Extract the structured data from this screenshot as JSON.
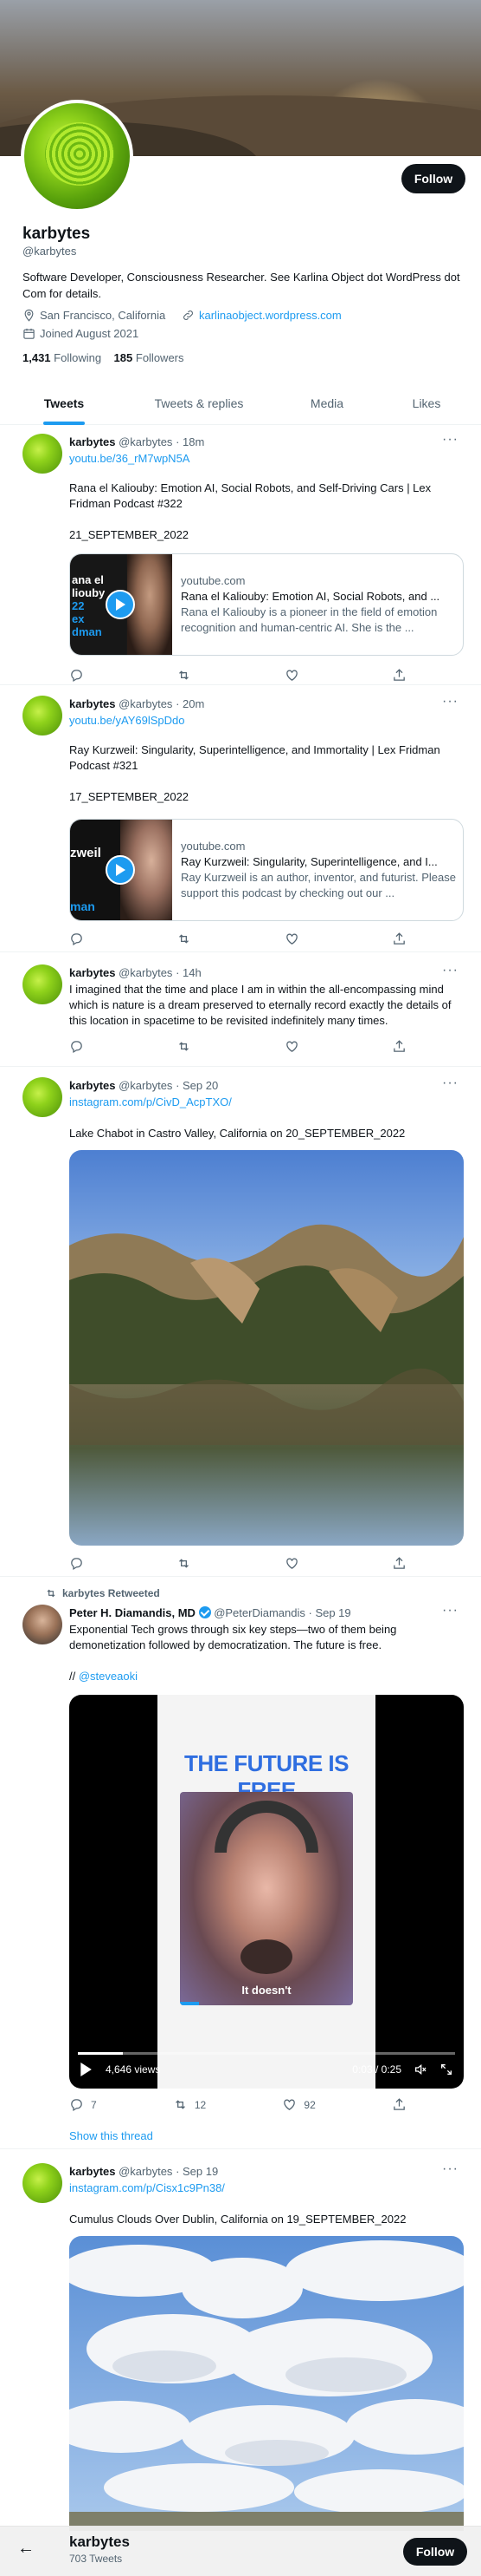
{
  "profile": {
    "name": "karbytes",
    "handle": "@karbytes",
    "bio": "Software Developer, Consciousness Researcher. See Karlina Object dot WordPress dot Com for details.",
    "location": "San Francisco, California",
    "website": "karlinaobject.wordpress.com",
    "joined": "Joined August 2021",
    "following_count": "1,431",
    "following_label": "Following",
    "followers_count": "185",
    "followers_label": "Followers",
    "follow_button": "Follow"
  },
  "tabs": [
    {
      "label": "Tweets",
      "active": true
    },
    {
      "label": "Tweets & replies",
      "active": false
    },
    {
      "label": "Media",
      "active": false
    },
    {
      "label": "Likes",
      "active": false
    }
  ],
  "tweets": [
    {
      "name": "karbytes",
      "handle": "@karbytes",
      "time": "· 18m",
      "link": "youtu.be/36_rM7wpN5A",
      "text": "Rana el Kaliouby: Emotion AI, Social Robots, and Self-Driving Cars | Lex Fridman Podcast #322",
      "date": "21_SEPTEMBER_2022",
      "card": {
        "domain": "youtube.com",
        "title": "Rana el Kaliouby: Emotion AI, Social Robots, and ...",
        "desc": "Rana el Kaliouby is a pioneer in the field of emotion recognition and human-centric AI. She is the ...",
        "thumb_text": [
          "ana el",
          "liouby",
          "22",
          "ex",
          "dman"
        ]
      }
    },
    {
      "name": "karbytes",
      "handle": "@karbytes",
      "time": "· 20m",
      "link": "youtu.be/yAY69lSpDdo",
      "text": "Ray Kurzweil: Singularity, Superintelligence, and Immortality | Lex Fridman Podcast #321",
      "date": "17_SEPTEMBER_2022",
      "card": {
        "domain": "youtube.com",
        "title": "Ray Kurzweil: Singularity, Superintelligence, and I...",
        "desc": "Ray Kurzweil is an author, inventor, and futurist. Please support this podcast by checking out our ...",
        "thumb_text": [
          "zweil",
          "man"
        ]
      }
    },
    {
      "name": "karbytes",
      "handle": "@karbytes",
      "time": "· 14h",
      "text": "I imagined that the time and place I am in within the all-encompassing mind which is nature is a dream preserved to eternally record exactly the details of this location in spacetime to be revisited indefinitely many times."
    },
    {
      "name": "karbytes",
      "handle": "@karbytes",
      "time": "· Sep 20",
      "link": "instagram.com/p/CivD_AcpTXO/",
      "text": "Lake Chabot in Castro Valley, California on 20_SEPTEMBER_2022"
    },
    {
      "retweet_label": "karbytes Retweeted",
      "name": "Peter H. Diamandis, MD",
      "handle": "@PeterDiamandis",
      "time": "· Sep 19",
      "text": "Exponential Tech grows through six key steps—two of them being demonetization followed by democratization. The future is free.",
      "mention_prefix": "// ",
      "mention": "@steveaoki",
      "video": {
        "headline": "THE FUTURE IS FREE",
        "caption": "It doesn't",
        "views": "4,646 views",
        "time": "0:03 / 0:25"
      },
      "replies": "7",
      "retweets": "12",
      "likes": "92",
      "show_thread": "Show this thread"
    },
    {
      "name": "karbytes",
      "handle": "@karbytes",
      "time": "· Sep 19",
      "link": "instagram.com/p/Cisx1c9Pn38/",
      "text": "Cumulus Clouds Over Dublin, California on 19_SEPTEMBER_2022"
    }
  ],
  "bottom_bar": {
    "name": "karbytes",
    "count": "703 Tweets",
    "follow_button": "Follow"
  },
  "colors": {
    "accent": "#1d9bf0",
    "text": "#0f1419",
    "secondary": "#536471"
  }
}
